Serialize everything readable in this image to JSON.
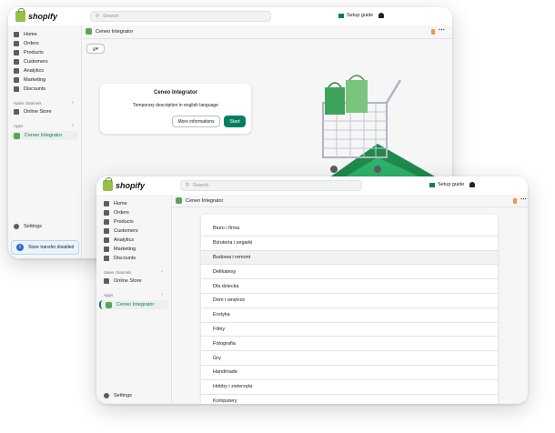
{
  "back_window": {
    "brand": "shopify",
    "search_placeholder": "Search",
    "setup_guide": "Setup guide",
    "nav": [
      {
        "label": "Home",
        "icon": "home-icon"
      },
      {
        "label": "Orders",
        "icon": "orders-icon"
      },
      {
        "label": "Products",
        "icon": "tag-icon"
      },
      {
        "label": "Customers",
        "icon": "customers-icon"
      },
      {
        "label": "Analytics",
        "icon": "analytics-icon"
      },
      {
        "label": "Marketing",
        "icon": "marketing-icon"
      },
      {
        "label": "Discounts",
        "icon": "discount-icon"
      }
    ],
    "sales_channels": "Sales channels",
    "online_store": "Online Store",
    "apps": "Apps",
    "app_item": "Ceneo Integrator",
    "settings": "Settings",
    "toast": "Store transfer disabled",
    "header_title": "Ceneo Integrator",
    "card": {
      "title": "Ceneo Integrator",
      "description": "Temporary description in english language",
      "more_button": "More informations",
      "start_button": "Start"
    }
  },
  "front_window": {
    "brand": "shopify",
    "search_placeholder": "Search",
    "setup_guide": "Setup guide",
    "nav": [
      {
        "label": "Home",
        "icon": "home-icon"
      },
      {
        "label": "Orders",
        "icon": "orders-icon"
      },
      {
        "label": "Products",
        "icon": "tag-icon"
      },
      {
        "label": "Customers",
        "icon": "customers-icon"
      },
      {
        "label": "Analytics",
        "icon": "analytics-icon"
      },
      {
        "label": "Marketing",
        "icon": "marketing-icon"
      },
      {
        "label": "Discounts",
        "icon": "discount-icon"
      }
    ],
    "sales_channels": "Sales channels",
    "online_store": "Online Store",
    "apps": "Apps",
    "app_item": "Ceneo Integrator",
    "settings": "Settings",
    "header_title": "Ceneo Integrator",
    "categories": [
      "Biuro i firma",
      "Biżuteria i zegarki",
      "Budowa i remont",
      "Delikatesy",
      "Dla dziecka",
      "Dom i wnętrze",
      "Erotyka",
      "Filmy",
      "Fotografia",
      "Gry",
      "Handmade",
      "Hobby i zwierzęta",
      "Komputery"
    ],
    "highlighted_category": "Budowa i remont"
  },
  "colors": {
    "accent": "#008060",
    "shopify_green": "#95bf47",
    "info_blue": "#2c6ecb"
  }
}
